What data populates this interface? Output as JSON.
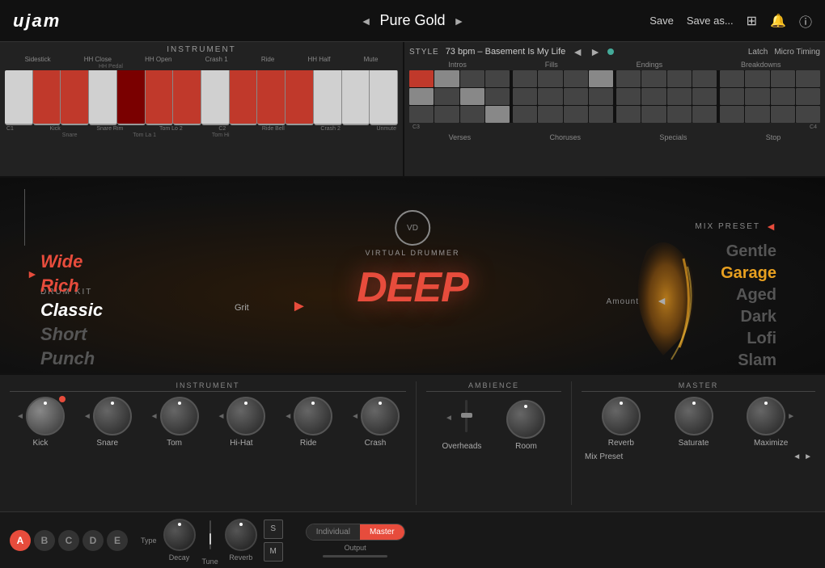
{
  "app": {
    "logo": "ujam",
    "preset_name": "Pure Gold",
    "nav_prev": "◄",
    "nav_next": "►",
    "save_label": "Save",
    "save_as_label": "Save as...",
    "icon_expand": "⊞",
    "icon_bell": "🔔",
    "icon_info": "ⓘ"
  },
  "instrument_panel": {
    "title": "INSTRUMENT",
    "labels_top": [
      "Sidestick",
      "HH Close",
      "HH Open",
      "Crash 1",
      "Ride",
      "HH Half",
      "Mute"
    ],
    "labels_top2": [
      "",
      "HH Pedal",
      "",
      "",
      "",
      "",
      ""
    ],
    "notes_bottom": [
      "C1",
      "",
      "",
      "",
      "",
      "",
      "C2",
      "",
      "",
      "",
      "",
      "",
      ""
    ],
    "labels_bottom": [
      "Kick",
      "Snare Rim",
      "Tom Lo 2",
      "",
      "Ride Bell",
      "",
      "Crash 2",
      "Unmute"
    ],
    "labels_bottom2": [
      "",
      "Snare",
      "Tom La 1",
      "Tom Hi",
      "",
      "",
      "",
      ""
    ]
  },
  "style_panel": {
    "title": "STYLE",
    "bpm_info": "73 bpm – Basement Is My Life",
    "latch_label": "Latch",
    "micro_timing_label": "Micro Timing",
    "categories_top": [
      "Intros",
      "Fills",
      "Endings",
      "Breakdowns"
    ],
    "note_markers": [
      "C3",
      "",
      "C4"
    ],
    "categories_bottom": [
      "Verses",
      "Choruses",
      "Specials",
      "Stop"
    ]
  },
  "drum_kit": {
    "label": "DRUM KIT",
    "arrow": "►",
    "items": [
      {
        "name": "Wide",
        "state": "hot"
      },
      {
        "name": "Rich",
        "state": "hot"
      },
      {
        "name": "Classic",
        "state": "active"
      },
      {
        "name": "Short",
        "state": "dim"
      },
      {
        "name": "Punch",
        "state": "dim"
      }
    ]
  },
  "virtual_drummer": {
    "circle_text": "VD",
    "subtitle": "VIRTUAL DRUMMER",
    "brand": "DEEP",
    "grit_label": "Grit"
  },
  "mix_preset": {
    "label": "MIX PRESET",
    "arrow": "◄",
    "amount_label": "Amount",
    "items": [
      {
        "name": "Gentle",
        "state": "dim"
      },
      {
        "name": "Garage",
        "state": "hot"
      },
      {
        "name": "Aged",
        "state": "dim"
      },
      {
        "name": "Dark",
        "state": "dim"
      },
      {
        "name": "Lofi",
        "state": "dim"
      },
      {
        "name": "Slam",
        "state": "dim"
      }
    ]
  },
  "bottom": {
    "instrument": {
      "title": "INSTRUMENT",
      "channels": [
        {
          "name": "Kick",
          "active": true,
          "has_red_dot": true
        },
        {
          "name": "Snare",
          "active": false,
          "has_red_dot": false
        },
        {
          "name": "Tom",
          "active": false,
          "has_red_dot": false
        },
        {
          "name": "Hi-Hat",
          "active": false,
          "has_red_dot": false
        },
        {
          "name": "Ride",
          "active": false,
          "has_red_dot": false
        },
        {
          "name": "Crash",
          "active": false,
          "has_red_dot": false
        }
      ]
    },
    "ambience": {
      "title": "AMBIENCE",
      "channels": [
        {
          "name": "Overheads"
        },
        {
          "name": "Room"
        }
      ]
    },
    "master": {
      "title": "MASTER",
      "channels": [
        {
          "name": "Reverb"
        },
        {
          "name": "Saturate"
        },
        {
          "name": "Maximize"
        }
      ],
      "mix_preset_label": "Mix Preset"
    }
  },
  "toolbar": {
    "type_buttons": [
      {
        "label": "A",
        "active": true
      },
      {
        "label": "B",
        "active": false
      },
      {
        "label": "C",
        "active": false
      },
      {
        "label": "D",
        "active": false
      },
      {
        "label": "E",
        "active": false
      }
    ],
    "type_label": "Type",
    "decay_label": "Decay",
    "tune_label": "Tune",
    "reverb_label": "Reverb",
    "s_label": "S",
    "m_label": "M",
    "output_label": "Output",
    "output_individual": "Individual",
    "output_master": "Master"
  }
}
